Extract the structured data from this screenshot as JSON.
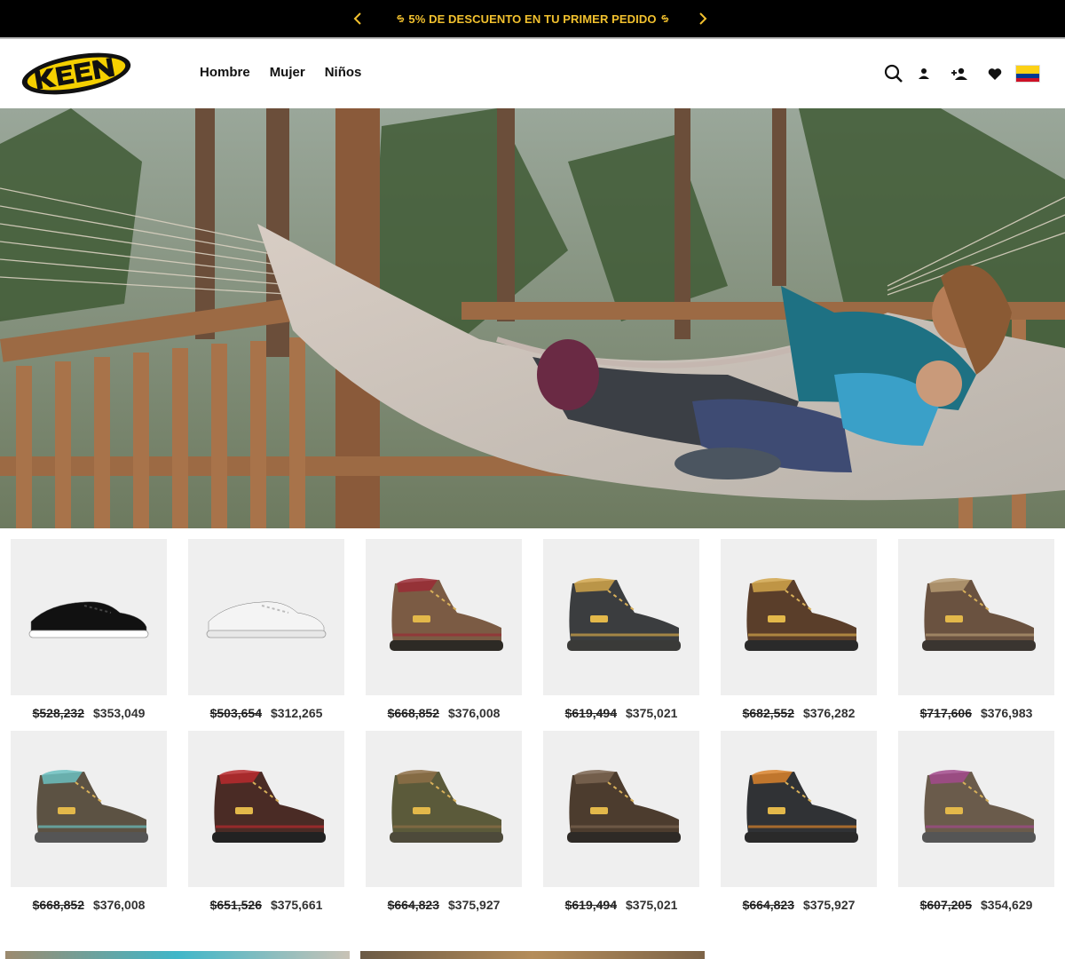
{
  "promo": {
    "text": "5% DE DESCUENTO EN TU PRIMER PEDIDO",
    "prev_icon": "chevron-left-icon",
    "next_icon": "chevron-right-icon",
    "accent": "#f2c12e"
  },
  "header": {
    "logo_text": "KEEN",
    "nav": [
      {
        "label": "Hombre"
      },
      {
        "label": "Mujer"
      },
      {
        "label": "Niños"
      }
    ],
    "icons": [
      "search-icon",
      "user-icon",
      "add-user-icon",
      "heart-icon",
      "colombia-flag-icon"
    ]
  },
  "products": [
    {
      "old": "$528,232",
      "new": "$353,049",
      "style": "sneaker-black"
    },
    {
      "old": "$503,654",
      "new": "$312,265",
      "style": "sneaker-white"
    },
    {
      "old": "$668,852",
      "new": "$376,008",
      "style": "boot-red"
    },
    {
      "old": "$619,494",
      "new": "$375,021",
      "style": "boot-grey"
    },
    {
      "old": "$682,552",
      "new": "$376,282",
      "style": "boot-brown"
    },
    {
      "old": "$717,606",
      "new": "$376,983",
      "style": "boot-brown-tan"
    },
    {
      "old": "$668,852",
      "new": "$376,008",
      "style": "boot-teal"
    },
    {
      "old": "$651,526",
      "new": "$375,661",
      "style": "boot-dark-red"
    },
    {
      "old": "$664,823",
      "new": "$375,927",
      "style": "boot-olive"
    },
    {
      "old": "$619,494",
      "new": "$375,021",
      "style": "boot-dark-brown"
    },
    {
      "old": "$664,823",
      "new": "$375,927",
      "style": "boot-black-orange"
    },
    {
      "old": "$607,205",
      "new": "$354,629",
      "style": "boot-purple"
    }
  ]
}
